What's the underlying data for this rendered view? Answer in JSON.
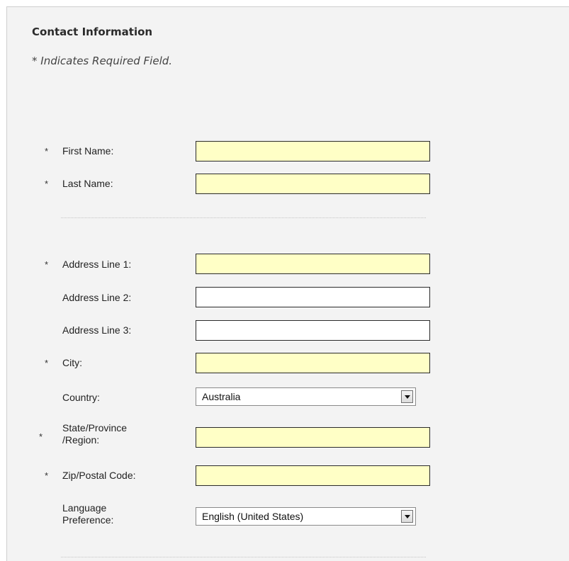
{
  "section": {
    "title": "Contact Information",
    "required_note": "* Indicates Required Field."
  },
  "required_marker": "*",
  "fields": {
    "first_name": {
      "label": "First Name:",
      "value": "",
      "required": true
    },
    "last_name": {
      "label": "Last Name:",
      "value": "",
      "required": true
    },
    "address1": {
      "label": "Address Line 1:",
      "value": "",
      "required": true
    },
    "address2": {
      "label": "Address Line 2:",
      "value": "",
      "required": false
    },
    "address3": {
      "label": "Address Line 3:",
      "value": "",
      "required": false
    },
    "city": {
      "label": "City:",
      "value": "",
      "required": true
    },
    "country": {
      "label": "Country:",
      "selected": "Australia",
      "required": false
    },
    "state": {
      "label_line1": "State/Province",
      "label_line2": "/Region:",
      "value": "",
      "required": true
    },
    "zip": {
      "label": "Zip/Postal Code:",
      "value": "",
      "required": true
    },
    "language": {
      "label_line1": "Language",
      "label_line2": "Preference:",
      "selected": "English (United States)",
      "required": false
    }
  },
  "colors": {
    "required_field_bg": "#ffffc6",
    "optional_field_bg": "#ffffff",
    "panel_bg": "#f3f3f3"
  }
}
